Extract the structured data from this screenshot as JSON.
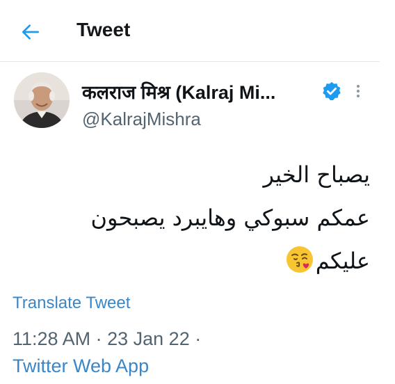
{
  "header": {
    "title": "Tweet",
    "back_icon": "arrow-left-icon"
  },
  "author": {
    "display_name": "कलराज मिश्र (Kalraj Mi...",
    "handle": "@KalrajMishra",
    "verified_icon": "verified-badge-icon",
    "more_icon": "more-vertical-icon",
    "avatar": "profile-photo"
  },
  "tweet": {
    "lines": [
      "يصباح الخير",
      "عمكم سبوكي وهايبرد يصبحون",
      "عليكم"
    ],
    "emoji": "kissing-face-with-heart-emoji"
  },
  "translate_label": "Translate Tweet",
  "meta": {
    "time": "11:28 AM",
    "date": "23 Jan 22",
    "separator": "·"
  },
  "source": "Twitter Web App",
  "colors": {
    "accent": "#3b86c6",
    "verified": "#1d9bf0",
    "secondary_text": "#536471"
  }
}
